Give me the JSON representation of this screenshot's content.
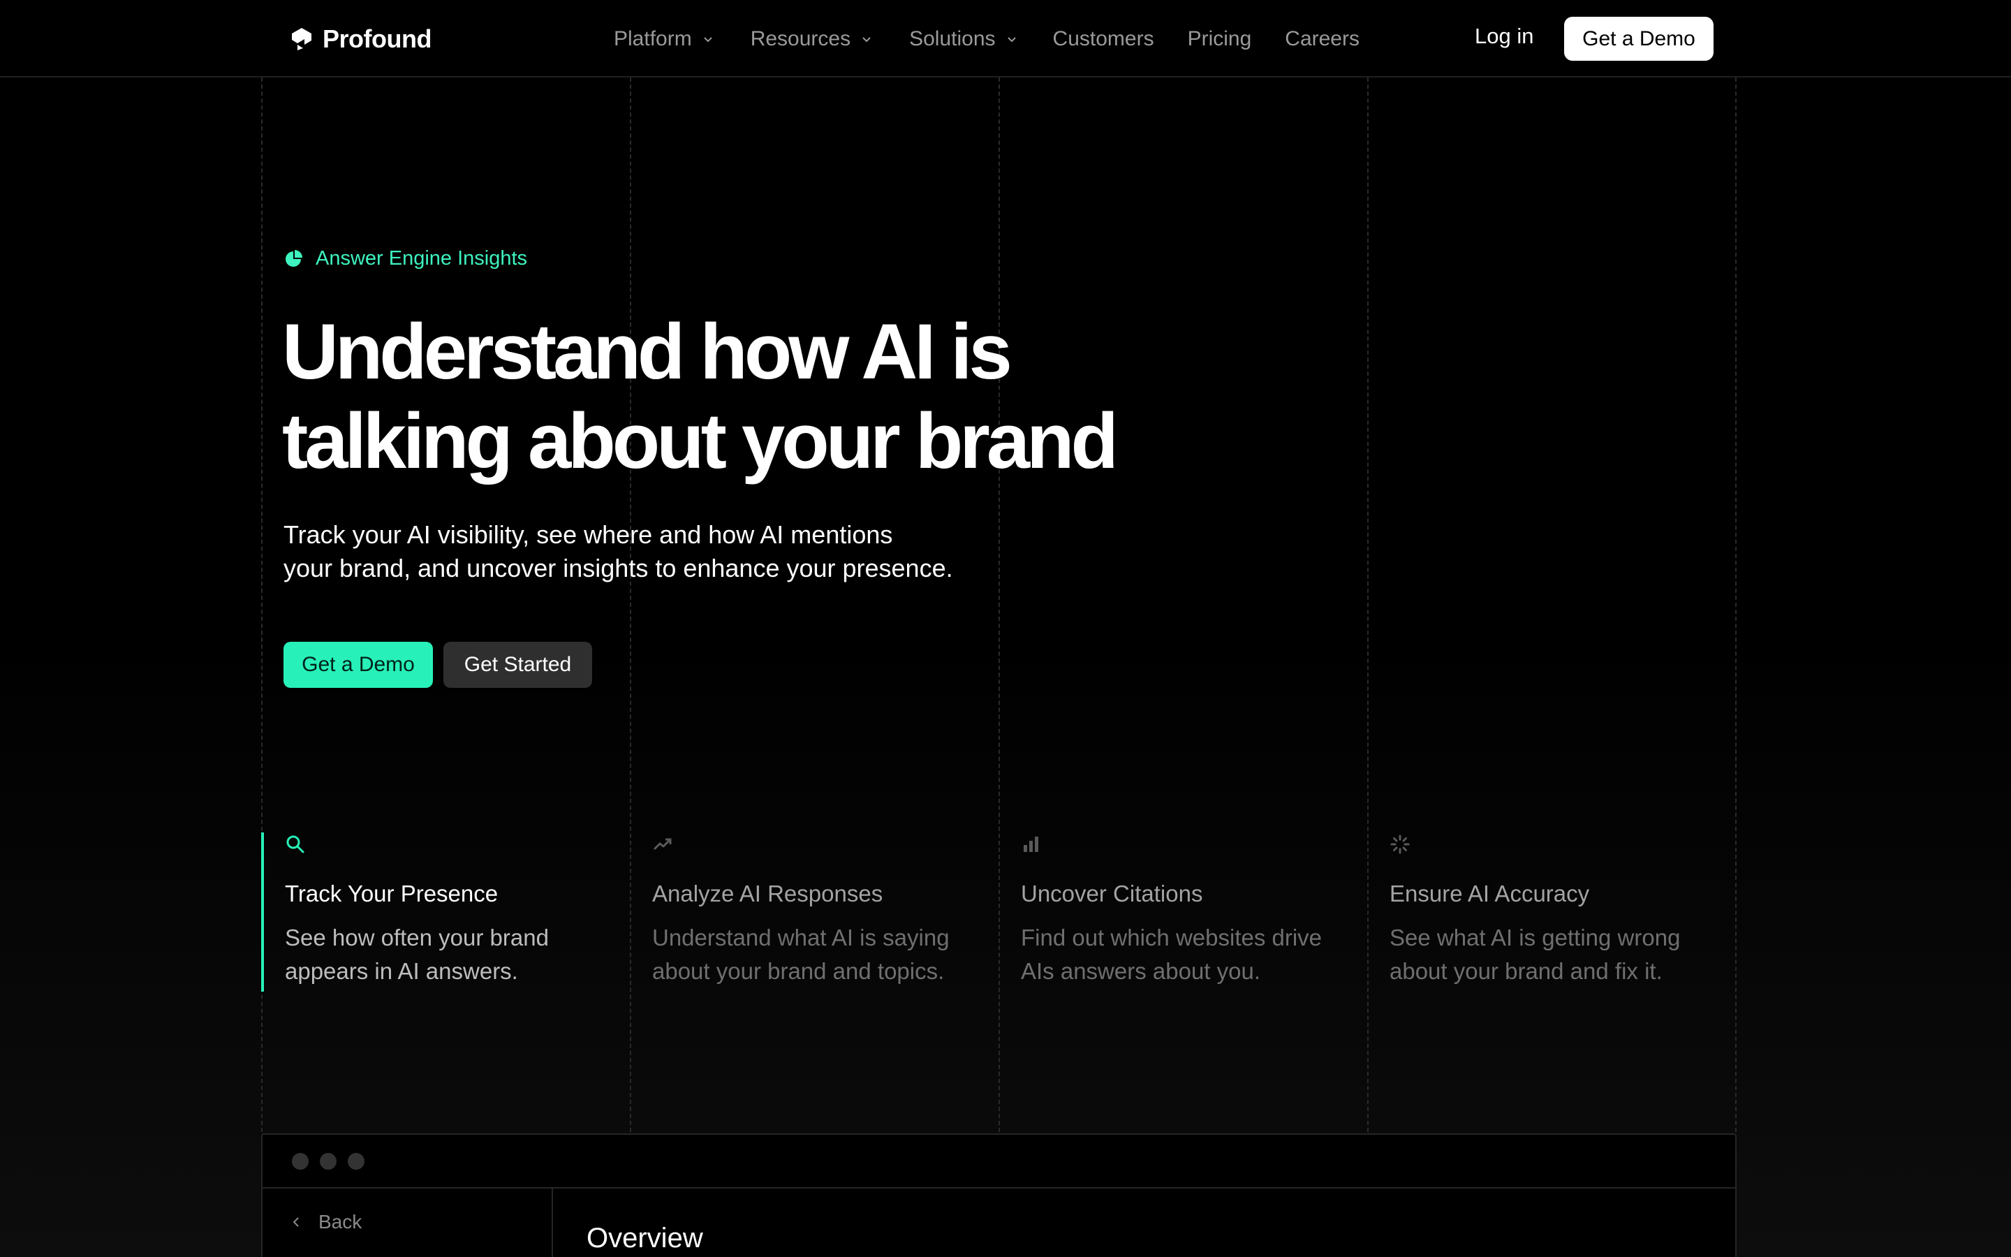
{
  "nav": {
    "brand": "Profound",
    "items": [
      {
        "label": "Platform",
        "has_dropdown": true
      },
      {
        "label": "Resources",
        "has_dropdown": true
      },
      {
        "label": "Solutions",
        "has_dropdown": true
      },
      {
        "label": "Customers",
        "has_dropdown": false
      },
      {
        "label": "Pricing",
        "has_dropdown": false
      },
      {
        "label": "Careers",
        "has_dropdown": false
      }
    ],
    "login": "Log in",
    "demo": "Get a Demo"
  },
  "hero": {
    "eyebrow": "Answer Engine Insights",
    "headline_line1": "Understand how AI is",
    "headline_line2": "talking about your brand",
    "sub_line1": "Track your AI visibility, see where and how AI mentions",
    "sub_line2": "your brand, and uncover insights to enhance your presence.",
    "primary_button": "Get a Demo",
    "secondary_button": "Get Started"
  },
  "features": [
    {
      "icon": "search-icon",
      "title": "Track Your Presence",
      "desc": "See how often your brand appears in AI answers.",
      "active": true
    },
    {
      "icon": "trending-up-icon",
      "title": "Analyze AI Responses",
      "desc": "Understand what AI is saying about your brand and topics.",
      "active": false
    },
    {
      "icon": "bar-chart-icon",
      "title": "Uncover Citations",
      "desc": "Find out which websites drive AIs answers about you.",
      "active": false
    },
    {
      "icon": "spinner-icon",
      "title": "Ensure AI Accuracy",
      "desc": "See what AI is getting wrong about your brand and fix it.",
      "active": false
    }
  ],
  "app": {
    "back_label": "Back",
    "page_title": "Overview"
  },
  "colors": {
    "accent": "#27f1b8",
    "background": "#000000"
  }
}
